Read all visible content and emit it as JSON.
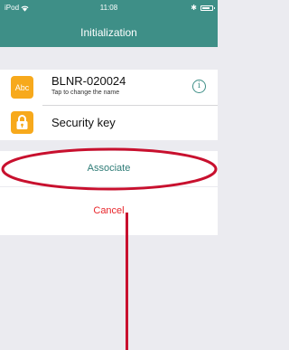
{
  "status_bar": {
    "carrier": "iPod",
    "time": "11:08",
    "bluetooth": "✱"
  },
  "nav": {
    "title": "Initialization"
  },
  "device_row": {
    "icon_label": "Abc",
    "name": "BLNR-020024",
    "subtitle": "Tap to change the name",
    "info_icon": "i"
  },
  "security_row": {
    "label": "Security key"
  },
  "actions": {
    "associate": "Associate",
    "cancel": "Cancel"
  },
  "colors": {
    "header": "#3e8f87",
    "icon_orange": "#f7a91c",
    "associate_text": "#2f7c77",
    "cancel_text": "#e8262b",
    "annotation": "#c8102e"
  }
}
